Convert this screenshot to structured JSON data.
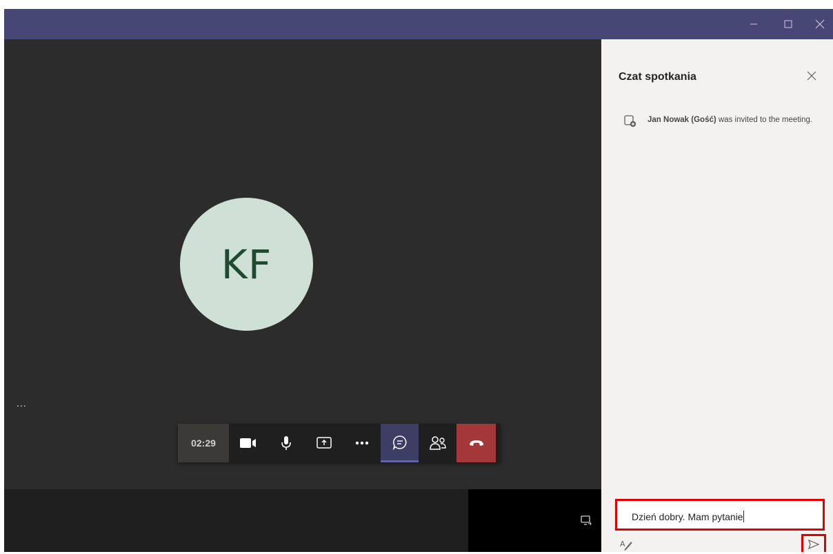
{
  "window": {
    "controls": [
      "minimize-icon",
      "maximize-icon",
      "close-icon"
    ]
  },
  "call": {
    "avatar_initials": "KF",
    "more_label": "...",
    "timer": "02:29",
    "toolbar_icons": [
      "camera-icon",
      "microphone-icon",
      "share-screen-icon",
      "more-actions-icon",
      "chat-icon",
      "participants-icon",
      "hang-up-icon"
    ],
    "active_button": "chat-icon"
  },
  "chat": {
    "title": "Czat spotkania",
    "system_message": {
      "name": "Jan Nowak (Gość)",
      "text": " was invited to the meeting."
    },
    "compose_value": "Dzień dobry. Mam pytanie"
  },
  "colors": {
    "titlebar": "#464775",
    "stage": "#2d2c2c",
    "avatar_bg": "#cfe0d6",
    "avatar_text": "#1e4a31",
    "hangup": "#a4373a",
    "panel": "#f3f2f1",
    "highlight": "#e00000"
  }
}
